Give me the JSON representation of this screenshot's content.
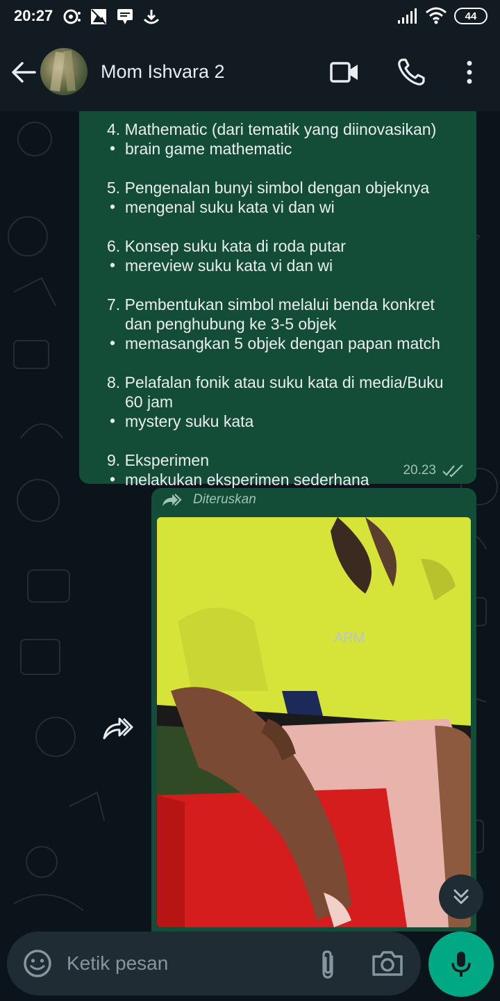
{
  "status_bar": {
    "time": "20:27",
    "battery": "44",
    "icons_left": [
      "whatsapp-status-icon",
      "gallery-icon",
      "message-icon",
      "download-icon"
    ],
    "icons_right": [
      "signal-icon",
      "wifi-icon",
      "battery-icon"
    ]
  },
  "header": {
    "contact_name": "Mom Ishvara 2",
    "icons": [
      "back-arrow-icon",
      "video-call-icon",
      "phone-icon",
      "more-vert-icon"
    ]
  },
  "messages": [
    {
      "type": "text",
      "direction": "outgoing",
      "lines": [
        "4. Mathematic (dari tematik yang diinovasikan)",
        "brain game mathematic",
        "5. Pengenalan bunyi simbol dengan objeknya",
        "mengenal suku kata vi dan wi",
        "6. Konsep suku kata di roda putar",
        "mereview suku kata vi dan wi",
        "7. Pembentukan simbol melalui benda konkret",
        "dan penghubung ke 3-5 objek",
        "memasangkan 5 objek dengan papan match",
        "8. Pelafalan fonik atau suku kata di media/Buku",
        "60 jam",
        "mystery suku kata",
        "9. Eksperimen",
        "melakukan eksperimen sederhana"
      ],
      "bullet": "•",
      "time": "20.23",
      "status": "read"
    },
    {
      "type": "image",
      "direction": "outgoing",
      "forwarded_label": "Diteruskan"
    }
  ],
  "input": {
    "placeholder": "Ketik pesan"
  },
  "colors": {
    "header_bg": "#111b21",
    "chat_bg": "#0b141a",
    "outgoing_bubble": "#144d37",
    "accent": "#00a884",
    "meta_text": "#9fc4b4"
  }
}
